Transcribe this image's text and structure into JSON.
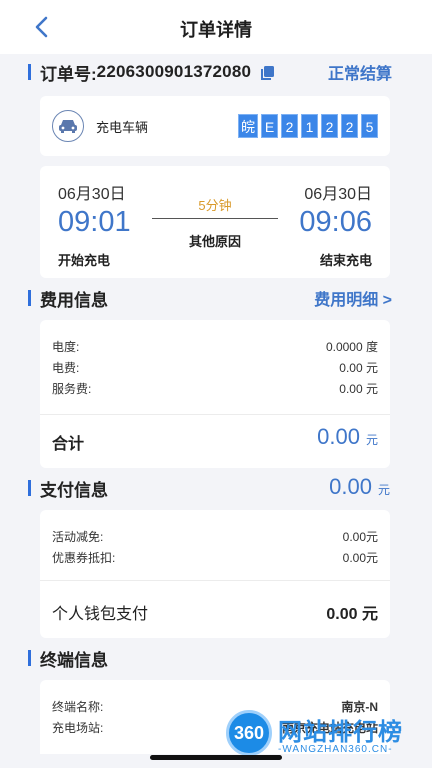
{
  "header": {
    "title": "订单详情"
  },
  "order": {
    "label": "订单号:",
    "number": "2206300901372080",
    "status_link": "正常结算"
  },
  "vehicle": {
    "label": "充电车辆",
    "plate": [
      "皖",
      "E",
      "2",
      "1",
      "2",
      "2",
      "5"
    ]
  },
  "session": {
    "start_date": "06月30日",
    "start_time": "09:01",
    "start_label": "开始充电",
    "end_date": "06月30日",
    "end_time": "09:06",
    "end_label": "结束充电",
    "duration": "5分钟",
    "stop_reason": "其他原因"
  },
  "fees": {
    "title": "费用信息",
    "detail_link": "费用明细 >",
    "rows": [
      {
        "key": "电度:",
        "value": "0.0000 度"
      },
      {
        "key": "电费:",
        "value": "0.00 元"
      },
      {
        "key": "服务费:",
        "value": "0.00 元"
      }
    ],
    "total_label": "合计",
    "total_value": "0.00",
    "total_unit": "元"
  },
  "payment": {
    "title": "支付信息",
    "amount": "0.00",
    "unit": "元",
    "rows": [
      {
        "key": "活动减免:",
        "value": "0.00元"
      },
      {
        "key": "优惠券抵扣:",
        "value": "0.00元"
      }
    ],
    "wallet_label": "个人钱包支付",
    "wallet_value": "0.00 元"
  },
  "terminal": {
    "title": "终端信息",
    "rows": [
      {
        "key": "终端名称:",
        "value": "南京-N"
      },
      {
        "key": "充电场站:",
        "value": "南京充电站充电站"
      }
    ]
  },
  "watermark": {
    "logo_text": "360",
    "title": "网站排行榜",
    "subtitle": "-WANGZHAN360.CN-"
  },
  "colors": {
    "accent": "#3f76c9",
    "highlight": "#d99a2b",
    "plate_blue": "#3b86e8"
  }
}
